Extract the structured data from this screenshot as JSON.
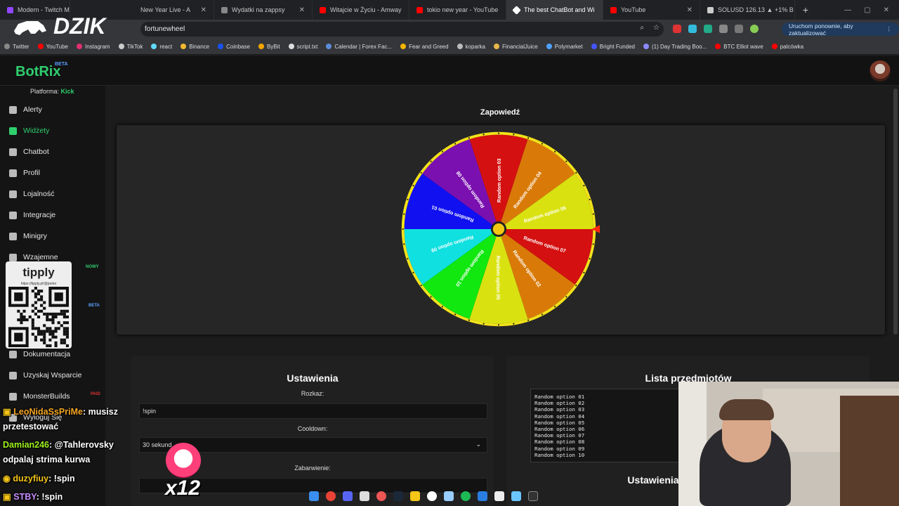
{
  "browser": {
    "tabs": [
      {
        "label": "Modern - Twitch Mode"
      },
      {
        "label": "New Year Live - A"
      },
      {
        "label": "Wydatki na zappsy"
      },
      {
        "label": "Witajcie w Życiu - Amway"
      },
      {
        "label": "tokio new year - YouTube"
      },
      {
        "label": "The best ChatBot and Wi"
      },
      {
        "label": "YouTube"
      },
      {
        "label": "SOLUSD 126.13 ▲ +1% B"
      }
    ],
    "url": "fortunewheel",
    "update_button": "Uruchom ponownie, aby zaktualizować",
    "bookmarks": [
      "Twitter",
      "YouTube",
      "Instagram",
      "TikTok",
      "react",
      "Binance",
      "Coinbase",
      "ByBit",
      "script.txt",
      "Calendar | Forex Fac...",
      "Fear and Greed",
      "koparka",
      "FinancialJuice",
      "Polymarket",
      "Bright Funded",
      "(1) Day Trading Boo...",
      "BTC Elliot wave",
      "palcówka"
    ]
  },
  "app": {
    "logo": "BotRix",
    "logo_badge": "BETA",
    "platform_label": "Platforma:",
    "platform_value": "Kick",
    "nav": [
      {
        "label": "Alerty",
        "icon": "alert-icon"
      },
      {
        "label": "Widżety",
        "icon": "widgets-icon"
      },
      {
        "label": "Chatbot",
        "icon": "robot-icon"
      },
      {
        "label": "Profil",
        "icon": "profile-icon"
      },
      {
        "label": "Lojalność",
        "icon": "trophy-icon"
      },
      {
        "label": "Integracje",
        "icon": "integrations-icon"
      },
      {
        "label": "Minigry",
        "icon": "gamepad-icon"
      },
      {
        "label": "Wzajemne",
        "icon": "music-icon"
      },
      {
        "label": "Dokumentacja",
        "icon": "document-icon"
      },
      {
        "label": "Uzyskaj Wsparcie",
        "icon": "support-icon"
      },
      {
        "label": "MonsterBuilds",
        "icon": "monitor-icon"
      },
      {
        "label": "Wyloguj Się",
        "icon": "logout-icon"
      }
    ],
    "badges": {
      "new": "NOWY",
      "beta": "BETA",
      "paid": "PAID"
    }
  },
  "preview": {
    "title": "Zapowiedź",
    "wheel_options": [
      "Random option 03",
      "Random option 04",
      "Random option 06",
      "Random option 07",
      "Random option 02",
      "Random option 05",
      "Random option 10",
      "Random option 09",
      "Random option 01",
      "Random option 08"
    ],
    "wheel_colors": [
      "#d41010",
      "#d97a08",
      "#d9e210",
      "#d41010",
      "#d97a08",
      "#d9e210",
      "#10e810",
      "#10e0e0",
      "#1010f0",
      "#7a10b0"
    ]
  },
  "settings": {
    "title": "Ustawienia",
    "command_label": "Rozkaz:",
    "command_value": "!spin",
    "cooldown_label": "Cooldown:",
    "cooldown_value": "30 sekund",
    "reward_label": "Zabarwienie:"
  },
  "items": {
    "title": "Lista przedmiotów",
    "list": [
      "Random option 01",
      "Random option 02",
      "Random option 03",
      "Random option 04",
      "Random option 05",
      "Random option 06",
      "Random option 07",
      "Random option 08",
      "Random option 09",
      "Random option 10"
    ],
    "settings_title": "Ustawienia"
  },
  "overlay": {
    "brand": "DZIK",
    "donate_brand": "tipply",
    "donate_url": "https://tipply.pl/@potiro",
    "gift_count": "x12",
    "chat": [
      {
        "user": "LeoNidaSsPriMe",
        "message": ": musisz"
      },
      {
        "user": "",
        "message": "przetestować"
      },
      {
        "user": "Damian246",
        "message": ": @Tahlerovsky"
      },
      {
        "user": "",
        "message": "odpalaj strima kurwa"
      },
      {
        "user": "duzyfiuy",
        "message": ": !spin"
      },
      {
        "user": "STBY",
        "message": ": !spin"
      }
    ]
  }
}
